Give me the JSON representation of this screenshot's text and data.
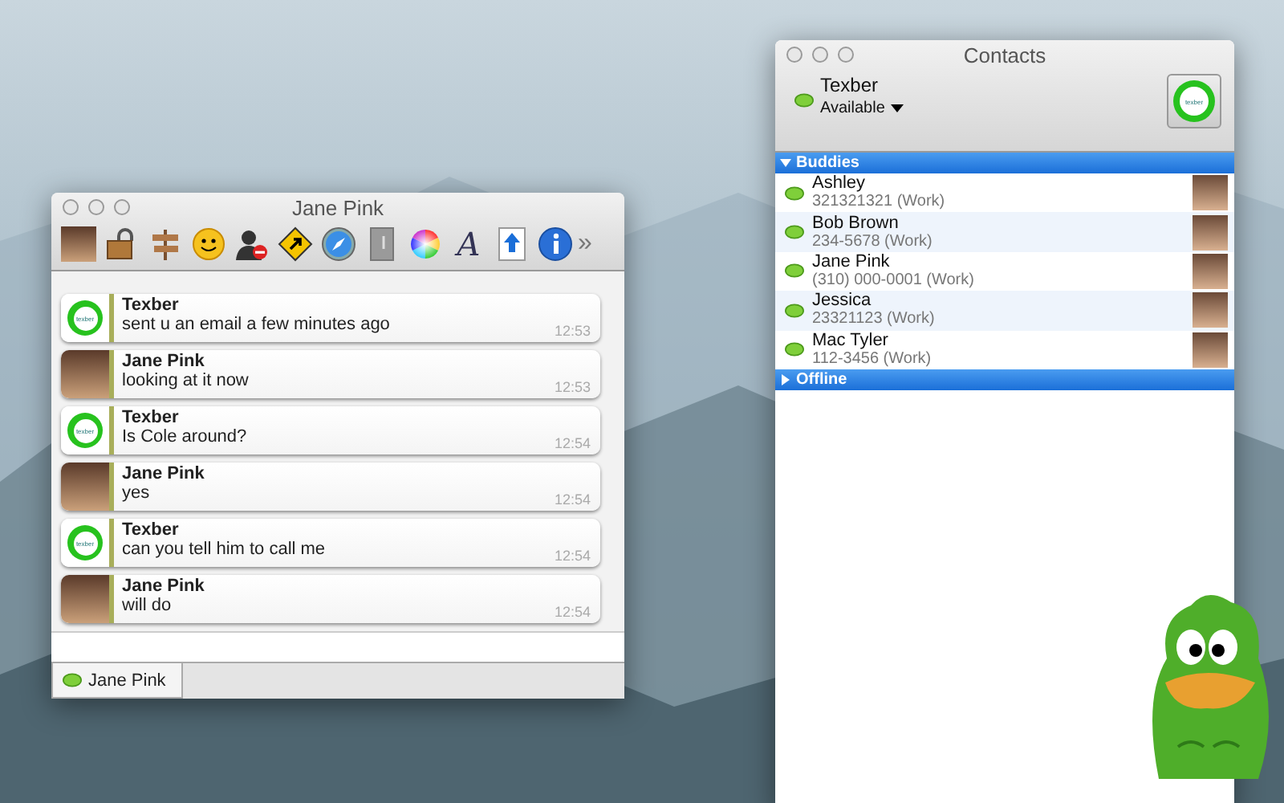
{
  "chat_window": {
    "title": "Jane Pink",
    "toolbar": [
      {
        "kind": "photo"
      },
      {
        "kind": "lock"
      },
      {
        "kind": "sign"
      },
      {
        "kind": "smiley"
      },
      {
        "kind": "block"
      },
      {
        "kind": "diamond"
      },
      {
        "kind": "compass"
      },
      {
        "kind": "doc"
      },
      {
        "kind": "wheel"
      },
      {
        "kind": "font",
        "glyph": "A"
      },
      {
        "kind": "upload"
      },
      {
        "kind": "info"
      },
      {
        "kind": "more",
        "glyph": "»"
      }
    ],
    "messages": [
      {
        "kind": "logo",
        "logo_text": "texber",
        "sender": "Texber",
        "text": "sent u an email a few minutes ago",
        "time": "12:53"
      },
      {
        "kind": "photo",
        "sender": "Jane Pink",
        "text": "looking at it now",
        "time": "12:53"
      },
      {
        "kind": "logo",
        "logo_text": "texber",
        "sender": "Texber",
        "text": "Is Cole around?",
        "time": "12:54"
      },
      {
        "kind": "photo",
        "sender": "Jane Pink",
        "text": "yes",
        "time": "12:54"
      },
      {
        "kind": "logo",
        "logo_text": "texber",
        "sender": "Texber",
        "text": "can you tell him to call me",
        "time": "12:54"
      },
      {
        "kind": "photo",
        "sender": "Jane Pink",
        "text": "will do",
        "time": "12:54"
      }
    ],
    "tabs": [
      {
        "label": "Jane Pink",
        "selected": true
      }
    ]
  },
  "contacts_window": {
    "title": "Contacts",
    "account": {
      "name": "Texber",
      "status": "Available",
      "logo_text": "texber"
    },
    "groups": [
      {
        "name": "Buddies",
        "expanded": true,
        "contacts": [
          {
            "name": "Ashley",
            "detail": "321321321 (Work)"
          },
          {
            "name": "Bob Brown",
            "detail": "234-5678 (Work)"
          },
          {
            "name": "Jane Pink",
            "detail": "(310) 000-0001 (Work)"
          },
          {
            "name": "Jessica",
            "detail": "23321123 (Work)"
          },
          {
            "name": "Mac Tyler",
            "detail": "112-3456 (Work)"
          }
        ]
      },
      {
        "name": "Offline",
        "expanded": false
      }
    ]
  }
}
